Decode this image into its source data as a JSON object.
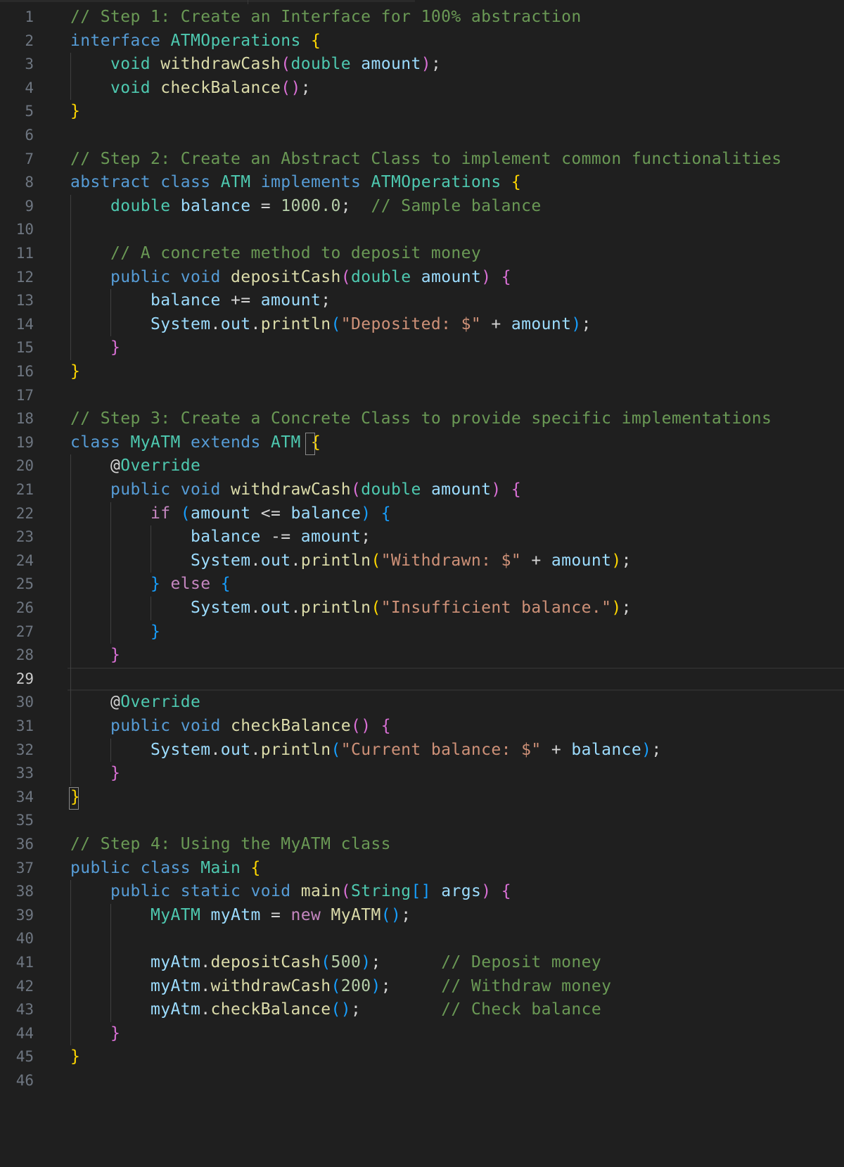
{
  "editor": {
    "cursor_line": 29,
    "lines": [
      {
        "n": "1",
        "tokens": [
          {
            "t": "// Step 1: Create an Interface for 100% abstraction",
            "c": "cm"
          }
        ]
      },
      {
        "n": "2",
        "tokens": [
          {
            "t": "interface ",
            "c": "kw"
          },
          {
            "t": "ATMOperations ",
            "c": "ty"
          },
          {
            "t": "{",
            "c": "b1"
          }
        ]
      },
      {
        "n": "3",
        "tokens": [
          {
            "t": "    ",
            "c": "pl"
          },
          {
            "t": "void ",
            "c": "ty"
          },
          {
            "t": "withdrawCash",
            "c": "fn"
          },
          {
            "t": "(",
            "c": "b2"
          },
          {
            "t": "double ",
            "c": "ty"
          },
          {
            "t": "amount",
            "c": "vr"
          },
          {
            "t": ")",
            "c": "b2"
          },
          {
            "t": ";",
            "c": "pl"
          }
        ]
      },
      {
        "n": "4",
        "tokens": [
          {
            "t": "    ",
            "c": "pl"
          },
          {
            "t": "void ",
            "c": "ty"
          },
          {
            "t": "checkBalance",
            "c": "fn"
          },
          {
            "t": "()",
            "c": "b2"
          },
          {
            "t": ";",
            "c": "pl"
          }
        ]
      },
      {
        "n": "5",
        "tokens": [
          {
            "t": "}",
            "c": "b1"
          }
        ]
      },
      {
        "n": "6",
        "tokens": []
      },
      {
        "n": "7",
        "tokens": [
          {
            "t": "// Step 2: Create an Abstract Class to implement common functionalities",
            "c": "cm"
          }
        ]
      },
      {
        "n": "8",
        "tokens": [
          {
            "t": "abstract ",
            "c": "kw"
          },
          {
            "t": "class ",
            "c": "kw"
          },
          {
            "t": "ATM ",
            "c": "ty"
          },
          {
            "t": "implements ",
            "c": "kw"
          },
          {
            "t": "ATMOperations ",
            "c": "ty"
          },
          {
            "t": "{",
            "c": "b1"
          }
        ]
      },
      {
        "n": "9",
        "tokens": [
          {
            "t": "    ",
            "c": "pl"
          },
          {
            "t": "double ",
            "c": "ty"
          },
          {
            "t": "balance",
            "c": "vr"
          },
          {
            "t": " = ",
            "c": "pl"
          },
          {
            "t": "1000.0",
            "c": "num"
          },
          {
            "t": ";  ",
            "c": "pl"
          },
          {
            "t": "// Sample balance",
            "c": "cm"
          }
        ]
      },
      {
        "n": "10",
        "tokens": []
      },
      {
        "n": "11",
        "tokens": [
          {
            "t": "    ",
            "c": "pl"
          },
          {
            "t": "// A concrete method to deposit money",
            "c": "cm"
          }
        ]
      },
      {
        "n": "12",
        "tokens": [
          {
            "t": "    ",
            "c": "pl"
          },
          {
            "t": "public ",
            "c": "kw"
          },
          {
            "t": "void ",
            "c": "kw"
          },
          {
            "t": "depositCash",
            "c": "fn"
          },
          {
            "t": "(",
            "c": "b2"
          },
          {
            "t": "double ",
            "c": "ty"
          },
          {
            "t": "amount",
            "c": "vr"
          },
          {
            "t": ") ",
            "c": "b2"
          },
          {
            "t": "{",
            "c": "b2"
          }
        ]
      },
      {
        "n": "13",
        "tokens": [
          {
            "t": "        ",
            "c": "pl"
          },
          {
            "t": "balance",
            "c": "vr"
          },
          {
            "t": " += ",
            "c": "pl"
          },
          {
            "t": "amount",
            "c": "vr"
          },
          {
            "t": ";",
            "c": "pl"
          }
        ]
      },
      {
        "n": "14",
        "tokens": [
          {
            "t": "        ",
            "c": "pl"
          },
          {
            "t": "System",
            "c": "vr"
          },
          {
            "t": ".",
            "c": "pl"
          },
          {
            "t": "out",
            "c": "vr"
          },
          {
            "t": ".",
            "c": "pl"
          },
          {
            "t": "println",
            "c": "fn"
          },
          {
            "t": "(",
            "c": "b3"
          },
          {
            "t": "\"Deposited: $\"",
            "c": "str"
          },
          {
            "t": " + ",
            "c": "pl"
          },
          {
            "t": "amount",
            "c": "vr"
          },
          {
            "t": ")",
            "c": "b3"
          },
          {
            "t": ";",
            "c": "pl"
          }
        ]
      },
      {
        "n": "15",
        "tokens": [
          {
            "t": "    ",
            "c": "pl"
          },
          {
            "t": "}",
            "c": "b2"
          }
        ]
      },
      {
        "n": "16",
        "tokens": [
          {
            "t": "}",
            "c": "b1"
          }
        ]
      },
      {
        "n": "17",
        "tokens": []
      },
      {
        "n": "18",
        "tokens": [
          {
            "t": "// Step 3: Create a Concrete Class to provide specific implementations",
            "c": "cm"
          }
        ]
      },
      {
        "n": "19",
        "tokens": [
          {
            "t": "class ",
            "c": "kw"
          },
          {
            "t": "MyATM ",
            "c": "ty"
          },
          {
            "t": "extends ",
            "c": "kw"
          },
          {
            "t": "ATM ",
            "c": "ty"
          },
          {
            "t": "{",
            "c": "b1"
          }
        ]
      },
      {
        "n": "20",
        "tokens": [
          {
            "t": "    ",
            "c": "pl"
          },
          {
            "t": "@",
            "c": "pl"
          },
          {
            "t": "Override",
            "c": "ty"
          }
        ]
      },
      {
        "n": "21",
        "tokens": [
          {
            "t": "    ",
            "c": "pl"
          },
          {
            "t": "public ",
            "c": "kw"
          },
          {
            "t": "void ",
            "c": "kw"
          },
          {
            "t": "withdrawCash",
            "c": "fn"
          },
          {
            "t": "(",
            "c": "b2"
          },
          {
            "t": "double ",
            "c": "ty"
          },
          {
            "t": "amount",
            "c": "vr"
          },
          {
            "t": ") ",
            "c": "b2"
          },
          {
            "t": "{",
            "c": "b2"
          }
        ]
      },
      {
        "n": "22",
        "tokens": [
          {
            "t": "        ",
            "c": "pl"
          },
          {
            "t": "if ",
            "c": "ctl"
          },
          {
            "t": "(",
            "c": "b3"
          },
          {
            "t": "amount",
            "c": "vr"
          },
          {
            "t": " <= ",
            "c": "pl"
          },
          {
            "t": "balance",
            "c": "vr"
          },
          {
            "t": ") ",
            "c": "b3"
          },
          {
            "t": "{",
            "c": "b3"
          }
        ]
      },
      {
        "n": "23",
        "tokens": [
          {
            "t": "            ",
            "c": "pl"
          },
          {
            "t": "balance",
            "c": "vr"
          },
          {
            "t": " -= ",
            "c": "pl"
          },
          {
            "t": "amount",
            "c": "vr"
          },
          {
            "t": ";",
            "c": "pl"
          }
        ]
      },
      {
        "n": "24",
        "tokens": [
          {
            "t": "            ",
            "c": "pl"
          },
          {
            "t": "System",
            "c": "vr"
          },
          {
            "t": ".",
            "c": "pl"
          },
          {
            "t": "out",
            "c": "vr"
          },
          {
            "t": ".",
            "c": "pl"
          },
          {
            "t": "println",
            "c": "fn"
          },
          {
            "t": "(",
            "c": "b1"
          },
          {
            "t": "\"Withdrawn: $\"",
            "c": "str"
          },
          {
            "t": " + ",
            "c": "pl"
          },
          {
            "t": "amount",
            "c": "vr"
          },
          {
            "t": ")",
            "c": "b1"
          },
          {
            "t": ";",
            "c": "pl"
          }
        ]
      },
      {
        "n": "25",
        "tokens": [
          {
            "t": "        ",
            "c": "pl"
          },
          {
            "t": "} ",
            "c": "b3"
          },
          {
            "t": "else ",
            "c": "ctl"
          },
          {
            "t": "{",
            "c": "b3"
          }
        ]
      },
      {
        "n": "26",
        "tokens": [
          {
            "t": "            ",
            "c": "pl"
          },
          {
            "t": "System",
            "c": "vr"
          },
          {
            "t": ".",
            "c": "pl"
          },
          {
            "t": "out",
            "c": "vr"
          },
          {
            "t": ".",
            "c": "pl"
          },
          {
            "t": "println",
            "c": "fn"
          },
          {
            "t": "(",
            "c": "b1"
          },
          {
            "t": "\"Insufficient balance.\"",
            "c": "str"
          },
          {
            "t": ")",
            "c": "b1"
          },
          {
            "t": ";",
            "c": "pl"
          }
        ]
      },
      {
        "n": "27",
        "tokens": [
          {
            "t": "        ",
            "c": "pl"
          },
          {
            "t": "}",
            "c": "b3"
          }
        ]
      },
      {
        "n": "28",
        "tokens": [
          {
            "t": "    ",
            "c": "pl"
          },
          {
            "t": "}",
            "c": "b2"
          }
        ]
      },
      {
        "n": "29",
        "tokens": []
      },
      {
        "n": "30",
        "tokens": [
          {
            "t": "    ",
            "c": "pl"
          },
          {
            "t": "@",
            "c": "pl"
          },
          {
            "t": "Override",
            "c": "ty"
          }
        ]
      },
      {
        "n": "31",
        "tokens": [
          {
            "t": "    ",
            "c": "pl"
          },
          {
            "t": "public ",
            "c": "kw"
          },
          {
            "t": "void ",
            "c": "kw"
          },
          {
            "t": "checkBalance",
            "c": "fn"
          },
          {
            "t": "() ",
            "c": "b2"
          },
          {
            "t": "{",
            "c": "b2"
          }
        ]
      },
      {
        "n": "32",
        "tokens": [
          {
            "t": "        ",
            "c": "pl"
          },
          {
            "t": "System",
            "c": "vr"
          },
          {
            "t": ".",
            "c": "pl"
          },
          {
            "t": "out",
            "c": "vr"
          },
          {
            "t": ".",
            "c": "pl"
          },
          {
            "t": "println",
            "c": "fn"
          },
          {
            "t": "(",
            "c": "b3"
          },
          {
            "t": "\"Current balance: $\"",
            "c": "str"
          },
          {
            "t": " + ",
            "c": "pl"
          },
          {
            "t": "balance",
            "c": "vr"
          },
          {
            "t": ")",
            "c": "b3"
          },
          {
            "t": ";",
            "c": "pl"
          }
        ]
      },
      {
        "n": "33",
        "tokens": [
          {
            "t": "    ",
            "c": "pl"
          },
          {
            "t": "}",
            "c": "b2"
          }
        ]
      },
      {
        "n": "34",
        "tokens": [
          {
            "t": "}",
            "c": "b1"
          }
        ]
      },
      {
        "n": "35",
        "tokens": []
      },
      {
        "n": "36",
        "tokens": [
          {
            "t": "// Step 4: Using the MyATM class",
            "c": "cm"
          }
        ]
      },
      {
        "n": "37",
        "tokens": [
          {
            "t": "public ",
            "c": "kw"
          },
          {
            "t": "class ",
            "c": "kw"
          },
          {
            "t": "Main ",
            "c": "ty"
          },
          {
            "t": "{",
            "c": "b1"
          }
        ]
      },
      {
        "n": "38",
        "tokens": [
          {
            "t": "    ",
            "c": "pl"
          },
          {
            "t": "public ",
            "c": "kw"
          },
          {
            "t": "static ",
            "c": "kw"
          },
          {
            "t": "void ",
            "c": "kw"
          },
          {
            "t": "main",
            "c": "fn"
          },
          {
            "t": "(",
            "c": "b2"
          },
          {
            "t": "String",
            "c": "ty"
          },
          {
            "t": "[]",
            "c": "b3"
          },
          {
            "t": " ",
            "c": "pl"
          },
          {
            "t": "args",
            "c": "vr"
          },
          {
            "t": ") ",
            "c": "b2"
          },
          {
            "t": "{",
            "c": "b2"
          }
        ]
      },
      {
        "n": "39",
        "tokens": [
          {
            "t": "        ",
            "c": "pl"
          },
          {
            "t": "MyATM ",
            "c": "ty"
          },
          {
            "t": "myAtm",
            "c": "vr"
          },
          {
            "t": " = ",
            "c": "pl"
          },
          {
            "t": "new ",
            "c": "ctl"
          },
          {
            "t": "MyATM",
            "c": "fn"
          },
          {
            "t": "()",
            "c": "b3"
          },
          {
            "t": ";",
            "c": "pl"
          }
        ]
      },
      {
        "n": "40",
        "tokens": []
      },
      {
        "n": "41",
        "tokens": [
          {
            "t": "        ",
            "c": "pl"
          },
          {
            "t": "myAtm",
            "c": "vr"
          },
          {
            "t": ".",
            "c": "pl"
          },
          {
            "t": "depositCash",
            "c": "fn"
          },
          {
            "t": "(",
            "c": "b3"
          },
          {
            "t": "500",
            "c": "num"
          },
          {
            "t": ")",
            "c": "b3"
          },
          {
            "t": ";      ",
            "c": "pl"
          },
          {
            "t": "// Deposit money",
            "c": "cm"
          }
        ]
      },
      {
        "n": "42",
        "tokens": [
          {
            "t": "        ",
            "c": "pl"
          },
          {
            "t": "myAtm",
            "c": "vr"
          },
          {
            "t": ".",
            "c": "pl"
          },
          {
            "t": "withdrawCash",
            "c": "fn"
          },
          {
            "t": "(",
            "c": "b3"
          },
          {
            "t": "200",
            "c": "num"
          },
          {
            "t": ")",
            "c": "b3"
          },
          {
            "t": ";     ",
            "c": "pl"
          },
          {
            "t": "// Withdraw money",
            "c": "cm"
          }
        ]
      },
      {
        "n": "43",
        "tokens": [
          {
            "t": "        ",
            "c": "pl"
          },
          {
            "t": "myAtm",
            "c": "vr"
          },
          {
            "t": ".",
            "c": "pl"
          },
          {
            "t": "checkBalance",
            "c": "fn"
          },
          {
            "t": "()",
            "c": "b3"
          },
          {
            "t": ";        ",
            "c": "pl"
          },
          {
            "t": "// Check balance",
            "c": "cm"
          }
        ]
      },
      {
        "n": "44",
        "tokens": [
          {
            "t": "    ",
            "c": "pl"
          },
          {
            "t": "}",
            "c": "b2"
          }
        ]
      },
      {
        "n": "45",
        "tokens": [
          {
            "t": "}",
            "c": "b1"
          }
        ]
      },
      {
        "n": "46",
        "tokens": []
      }
    ]
  }
}
